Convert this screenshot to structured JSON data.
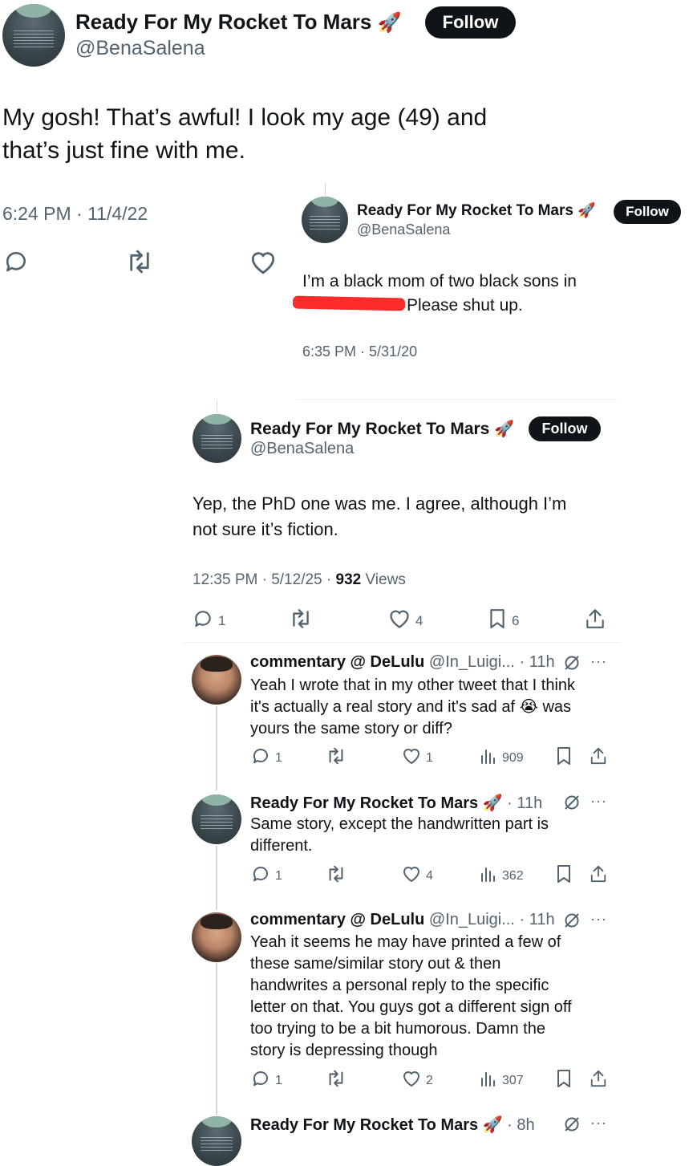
{
  "colors": {
    "text": "#0f1419",
    "secondary": "#536471",
    "follow_bg": "#0f1419",
    "redaction": "#ff2a2a"
  },
  "main_tweet": {
    "name": "Ready For My Rocket To Mars",
    "emoji": "🚀",
    "handle": "@BenaSalena",
    "follow": "Follow",
    "text_line1": "My gosh! That’s awful! I look my age (49) and",
    "text_line2": "that’s just fine with me.",
    "timestamp": "6:24 PM · 11/4/22",
    "icons": [
      "reply-icon",
      "retweet-icon",
      "like-icon"
    ]
  },
  "quote_1": {
    "name": "Ready For My Rocket To Mars",
    "emoji": "🚀",
    "handle": "@BenaSalena",
    "follow": "Follow",
    "text_line1": "I’m a black mom of two black sons in",
    "text_line2_visible": "Please shut up.",
    "timestamp": "6:35 PM · 5/31/20"
  },
  "quote_2": {
    "name": "Ready For My Rocket To Mars",
    "emoji": "🚀",
    "handle": "@BenaSalena",
    "follow": "Follow",
    "text_line1": "Yep, the PhD one was me. I agree, although I’m",
    "text_line2": "not sure it’s fiction.",
    "timestamp": "12:35 PM · 5/12/25 · ",
    "views_count": "932",
    "views_label": " Views",
    "actions": {
      "replies": "1",
      "likes": "4",
      "bookmarks": "6"
    }
  },
  "replies": [
    {
      "name": "commentary @ DeLulu",
      "handle": "@In_Luigi...",
      "time": " · 11h",
      "lines": [
        "Yeah I wrote that in my other tweet that I think",
        "it's actually a real story and it's sad af 😭 was",
        "yours the same story or diff?"
      ],
      "replies": "1",
      "likes": "1",
      "views": "909"
    },
    {
      "name": "Ready For My Rocket To Mars 🚀",
      "handle": "",
      "time": " · 11h",
      "lines": [
        "Same story, except the handwritten part is",
        "different."
      ],
      "replies": "1",
      "likes": "4",
      "views": "362"
    },
    {
      "name": "commentary @ DeLulu",
      "handle": "@In_Luigi...",
      "time": " · 11h",
      "lines": [
        "Yeah it seems he may have printed a few of",
        "these same/similar story out & then",
        "handwrites a personal reply to the specific",
        "letter on that. You guys got a different sign off",
        "too trying to be a bit humorous. Damn the",
        "story is depressing though"
      ],
      "replies": "1",
      "likes": "2",
      "views": "307"
    },
    {
      "name": "Ready For My Rocket To Mars 🚀",
      "handle": "",
      "time": " · 8h"
    }
  ]
}
